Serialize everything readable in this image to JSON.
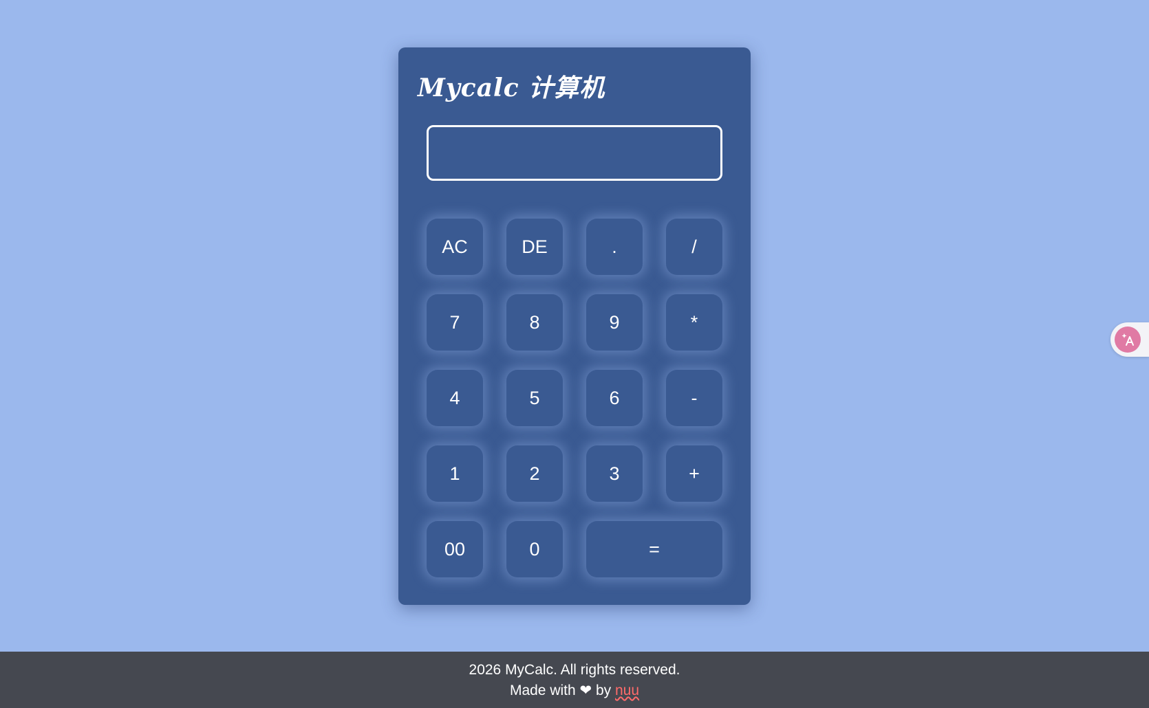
{
  "app": {
    "title": "Mycalc 计算机"
  },
  "display": {
    "value": "",
    "placeholder": ""
  },
  "keys": {
    "ac": "AC",
    "de": "DE",
    "dot": ".",
    "divide": "/",
    "seven": "7",
    "eight": "8",
    "nine": "9",
    "multiply": "*",
    "four": "4",
    "five": "5",
    "six": "6",
    "minus": "-",
    "one": "1",
    "two": "2",
    "three": "3",
    "plus": "+",
    "double_zero": "00",
    "zero": "0",
    "equals": "="
  },
  "footer": {
    "copyright": "2026 MyCalc. All rights reserved.",
    "made_with": "Made with",
    "heart": "❤",
    "by": "by",
    "author": "nuu"
  },
  "icons": {
    "translate": "translate-icon",
    "heart": "heart-icon"
  },
  "colors": {
    "background": "#9bb8ed",
    "panel": "#3a5a92",
    "footer": "#454850",
    "author_link": "#ff6b6b",
    "translate_accent": "#e07aa4"
  }
}
